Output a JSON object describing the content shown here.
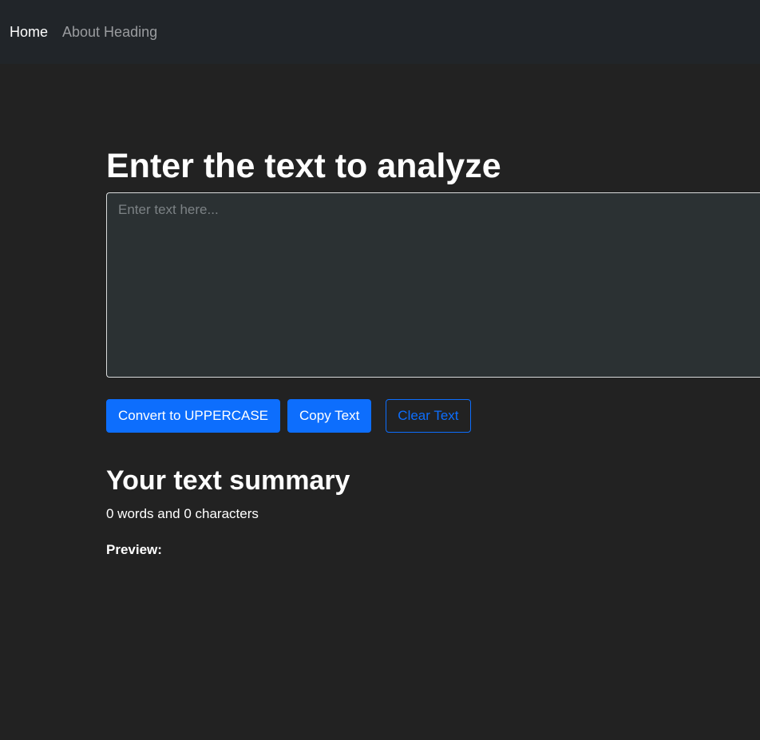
{
  "nav": {
    "items": [
      {
        "label": "Home"
      },
      {
        "label": "About Heading"
      }
    ]
  },
  "main": {
    "heading": "Enter the text to analyze",
    "textarea": {
      "value": "",
      "placeholder": "Enter text here..."
    },
    "buttons": {
      "uppercase": "Convert to UPPERCASE",
      "copy": "Copy Text",
      "clear": "Clear Text"
    }
  },
  "summary": {
    "title": "Your text summary",
    "word_count": 0,
    "char_count": 0,
    "stats_text": "0 words and 0 characters",
    "preview_label": "Preview:",
    "preview_text": ""
  },
  "colors": {
    "background": "#222222",
    "navbar": "#212529",
    "accent": "#0d6efd",
    "textarea_bg": "#2b3133"
  }
}
